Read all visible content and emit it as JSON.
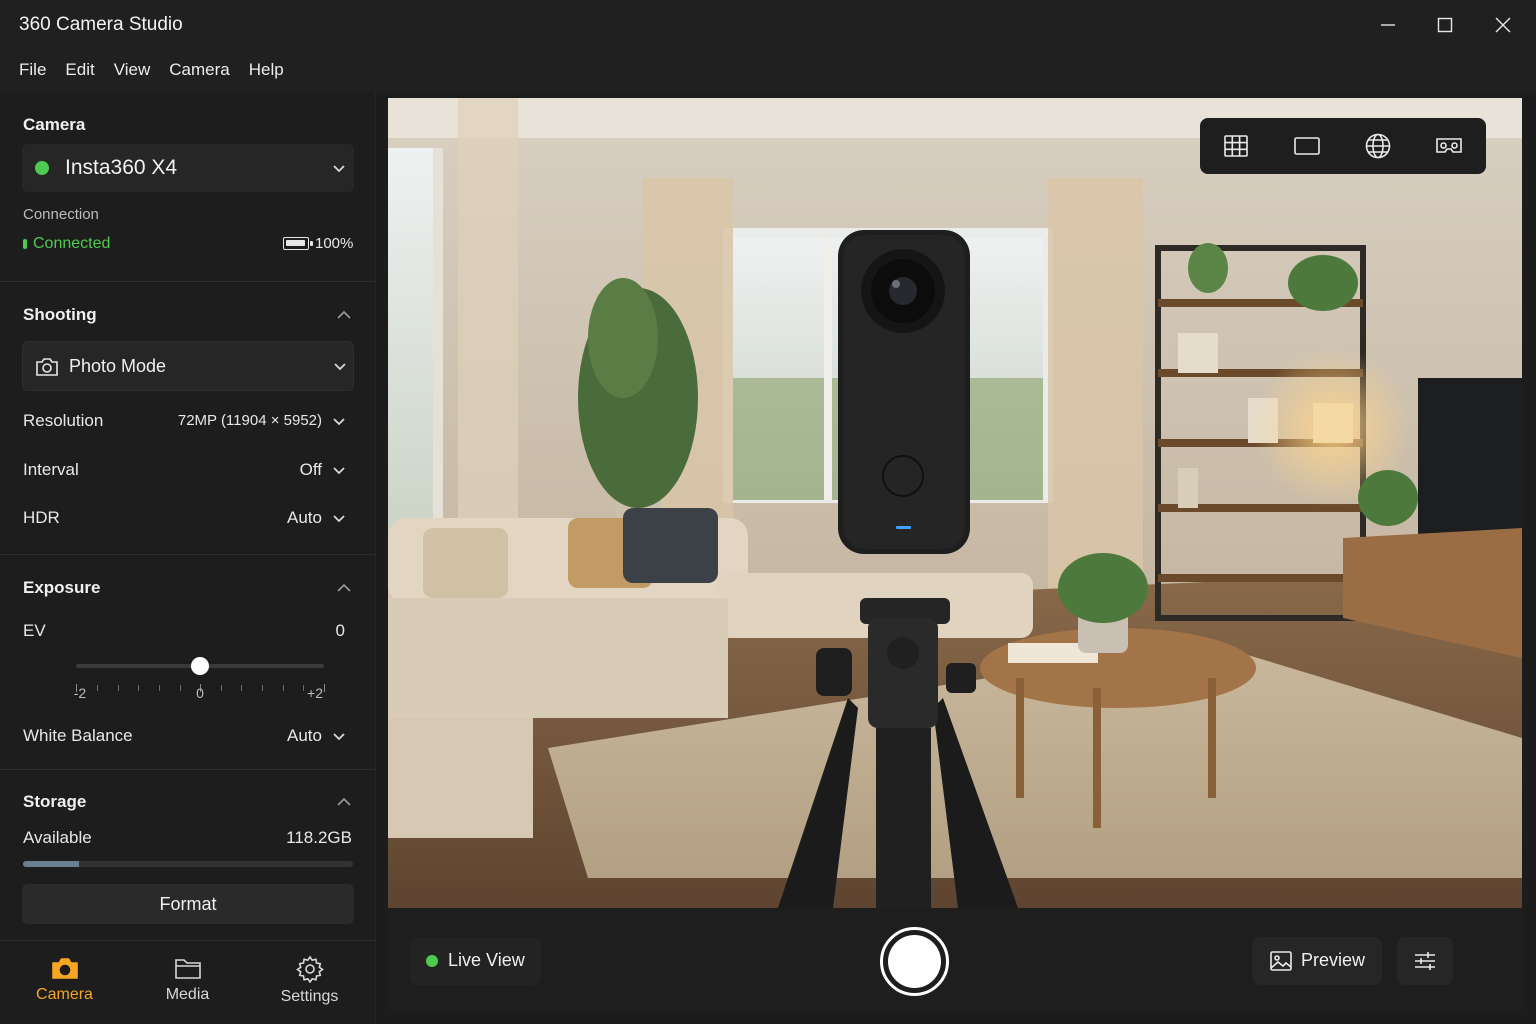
{
  "window": {
    "title": "360 Camera Studio",
    "controls": [
      "minimize-icon",
      "maximize-icon",
      "close-icon"
    ]
  },
  "menu": [
    "File",
    "Edit",
    "View",
    "Camera",
    "Help"
  ],
  "sidebar": {
    "camera": {
      "section_title": "Camera",
      "selected_camera": "Insta360 X4",
      "status_color": "#4ecb4e",
      "connection_label": "Connection",
      "connection_status": "Connected",
      "battery": "100%",
      "battery_level": 1.0
    },
    "shooting": {
      "section_title": "Shooting",
      "mode": "Photo Mode",
      "rows": [
        {
          "label": "Resolution",
          "value": "72MP (11904 × 5952)"
        },
        {
          "label": "Interval",
          "value": "Off"
        },
        {
          "label": "HDR",
          "value": "Auto"
        }
      ]
    },
    "exposure": {
      "section_title": "Exposure",
      "ev_label": "EV",
      "ev_value": "0",
      "ev_min_label": "-2",
      "ev_mid_label": "0",
      "ev_max_label": "+2",
      "ev_min": -2,
      "ev_max": 2,
      "ev_current": 0,
      "white_balance_label": "White Balance",
      "white_balance_value": "Auto"
    },
    "storage": {
      "section_title": "Storage",
      "available_label": "Available",
      "available_value": "118.2GB",
      "used_fraction": 0.17,
      "format_label": "Format"
    },
    "bottom_nav": [
      {
        "label": "Camera",
        "icon": "camera-icon",
        "active": true
      },
      {
        "label": "Media",
        "icon": "folder-icon",
        "active": false
      },
      {
        "label": "Settings",
        "icon": "gear-icon",
        "active": false
      }
    ]
  },
  "viewport": {
    "view_modes": [
      "grid-view-icon",
      "flat-view-icon",
      "globe-view-icon",
      "vr-view-icon"
    ]
  },
  "controls": {
    "live_view_label": "Live View",
    "live_color": "#4ecb4e",
    "preview_label": "Preview"
  },
  "colors": {
    "accent": "#f5a623",
    "connected": "#4ecb4e",
    "background": "#1c1c1c"
  }
}
